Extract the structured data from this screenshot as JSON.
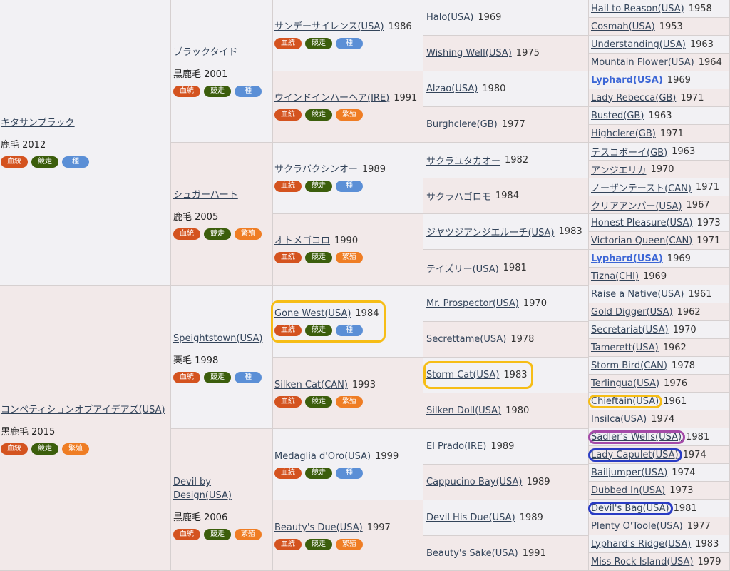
{
  "badge_labels": {
    "bloodline": "血統",
    "racing": "競走",
    "sire_role": "種",
    "breeding": "繁殖"
  },
  "gen1": [
    {
      "name": "キタサンブラック",
      "coat": "鹿毛 2012",
      "badges": [
        "bloodline",
        "racing",
        "sire_role"
      ]
    },
    {
      "name": "コンペティションオブアイデアズ(USA)",
      "coat": "黒鹿毛 2015",
      "badges": [
        "bloodline",
        "racing",
        "breeding"
      ]
    }
  ],
  "gen2": [
    {
      "name": "ブラックタイド",
      "coat": "黒鹿毛 2001",
      "badges": [
        "bloodline",
        "racing",
        "sire_role"
      ]
    },
    {
      "name": "シュガーハート",
      "coat": "鹿毛 2005",
      "badges": [
        "bloodline",
        "racing",
        "breeding"
      ]
    },
    {
      "name": "Speightstown(USA)",
      "coat": "栗毛 1998",
      "badges": [
        "bloodline",
        "racing",
        "sire_role"
      ]
    },
    {
      "name": "Devil by Design(USA)",
      "coat": "黒鹿毛 2006",
      "badges": [
        "bloodline",
        "racing",
        "breeding"
      ]
    }
  ],
  "gen3": [
    {
      "name": "サンデーサイレンス(USA)",
      "year": "1986",
      "badges": [
        "bloodline",
        "racing",
        "sire_role"
      ]
    },
    {
      "name": "ウインドインハーヘア(IRE)",
      "year": "1991",
      "badges": [
        "bloodline",
        "racing",
        "breeding"
      ]
    },
    {
      "name": "サクラバクシンオー",
      "year": "1989",
      "badges": [
        "bloodline",
        "racing",
        "sire_role"
      ]
    },
    {
      "name": "オトメゴコロ",
      "year": "1990",
      "badges": [
        "bloodline",
        "racing",
        "breeding"
      ]
    },
    {
      "name": "Gone West(USA)",
      "year": "1984",
      "badges": [
        "bloodline",
        "racing",
        "sire_role"
      ]
    },
    {
      "name": "Silken Cat(CAN)",
      "year": "1993",
      "badges": [
        "bloodline",
        "racing",
        "breeding"
      ]
    },
    {
      "name": "Medaglia d'Oro(USA)",
      "year": "1999",
      "badges": [
        "bloodline",
        "racing",
        "sire_role"
      ]
    },
    {
      "name": "Beauty's Due(USA)",
      "year": "1997",
      "badges": [
        "bloodline",
        "racing",
        "breeding"
      ]
    }
  ],
  "gen4": [
    {
      "name": "Halo(USA)",
      "year": "1969"
    },
    {
      "name": "Wishing Well(USA)",
      "year": "1975"
    },
    {
      "name": "Alzao(USA)",
      "year": "1980"
    },
    {
      "name": "Burghclere(GB)",
      "year": "1977"
    },
    {
      "name": "サクラユタカオー",
      "year": "1982"
    },
    {
      "name": "サクラハゴロモ",
      "year": "1984"
    },
    {
      "name": "ジヤツジアンジエルーチ(USA)",
      "year": "1983"
    },
    {
      "name": "テイズリー(USA)",
      "year": "1981"
    },
    {
      "name": "Mr. Prospector(USA)",
      "year": "1970"
    },
    {
      "name": "Secrettame(USA)",
      "year": "1978"
    },
    {
      "name": "Storm Cat(USA)",
      "year": "1983"
    },
    {
      "name": "Silken Doll(USA)",
      "year": "1980"
    },
    {
      "name": "El Prado(IRE)",
      "year": "1989"
    },
    {
      "name": "Cappucino Bay(USA)",
      "year": "1989"
    },
    {
      "name": "Devil His Due(USA)",
      "year": "1989"
    },
    {
      "name": "Beauty's Sake(USA)",
      "year": "1991"
    }
  ],
  "gen5": [
    {
      "name": "Hail to Reason(USA)",
      "year": "1958"
    },
    {
      "name": "Cosmah(USA)",
      "year": "1953"
    },
    {
      "name": "Understanding(USA)",
      "year": "1963"
    },
    {
      "name": "Mountain Flower(USA)",
      "year": "1964"
    },
    {
      "name": "Lyphard(USA)",
      "year": "1969",
      "bold": true
    },
    {
      "name": "Lady Rebecca(GB)",
      "year": "1971"
    },
    {
      "name": "Busted(GB)",
      "year": "1963"
    },
    {
      "name": "Highclere(GB)",
      "year": "1971"
    },
    {
      "name": "テスコボーイ(GB)",
      "year": "1963"
    },
    {
      "name": "アンジエリカ",
      "year": "1970"
    },
    {
      "name": "ノーザンテースト(CAN)",
      "year": "1971"
    },
    {
      "name": "クリアアンバー(USA)",
      "year": "1967"
    },
    {
      "name": "Honest Pleasure(USA)",
      "year": "1973"
    },
    {
      "name": "Victorian Queen(CAN)",
      "year": "1971"
    },
    {
      "name": "Lyphard(USA)",
      "year": "1969",
      "bold": true
    },
    {
      "name": "Tizna(CHI)",
      "year": "1969"
    },
    {
      "name": "Raise a Native(USA)",
      "year": "1961"
    },
    {
      "name": "Gold Digger(USA)",
      "year": "1962"
    },
    {
      "name": "Secretariat(USA)",
      "year": "1970"
    },
    {
      "name": "Tamerett(USA)",
      "year": "1962"
    },
    {
      "name": "Storm Bird(CAN)",
      "year": "1978"
    },
    {
      "name": "Terlingua(USA)",
      "year": "1976"
    },
    {
      "name": "Chieftain(USA)",
      "year": "1961"
    },
    {
      "name": "Insilca(USA)",
      "year": "1974"
    },
    {
      "name": "Sadler's Wells(USA)",
      "year": "1981"
    },
    {
      "name": "Lady Capulet(USA)",
      "year": "1974"
    },
    {
      "name": "Bailjumper(USA)",
      "year": "1974"
    },
    {
      "name": "Dubbed In(USA)",
      "year": "1973"
    },
    {
      "name": "Devil's Bag(USA)",
      "year": "1981"
    },
    {
      "name": "Plenty O'Toole(USA)",
      "year": "1977"
    },
    {
      "name": "Lyphard's Ridge(USA)",
      "year": "1983"
    },
    {
      "name": "Miss Rock Island(USA)",
      "year": "1979"
    }
  ],
  "highlights": [
    {
      "target": "gen3.4",
      "color": "#f6bd16"
    },
    {
      "target": "gen4.10",
      "color": "#f6bd16"
    },
    {
      "target": "gen5.22",
      "color": "#f6bd16"
    },
    {
      "target": "gen5.24",
      "color": "#a44aa8"
    },
    {
      "target": "gen5.25",
      "color": "#2a3cc4"
    },
    {
      "target": "gen5.28",
      "color": "#2a3cc4"
    }
  ]
}
